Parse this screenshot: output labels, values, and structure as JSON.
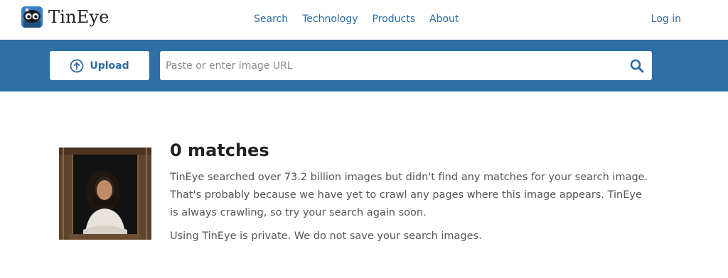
{
  "header": {
    "logo_text": "TinEye",
    "nav": [
      {
        "label": "Search"
      },
      {
        "label": "Technology"
      },
      {
        "label": "Products"
      },
      {
        "label": "About"
      }
    ],
    "login_label": "Log in"
  },
  "search": {
    "upload_label": "Upload",
    "url_placeholder": "Paste or enter image URL",
    "url_value": ""
  },
  "result": {
    "title": "0 matches",
    "message": "TinEye searched over 73.2 billion images but didn't find any matches for your search image. That's probably because we have yet to crawl any pages where this image appears. TinEye is always crawling, so try your search again soon.",
    "privacy": "Using TinEye is private. We do not save your search images."
  },
  "colors": {
    "brand_blue": "#2d6fa6",
    "link_blue": "#2b6aa3"
  },
  "icons": {
    "logo": "tineye-robot-logo",
    "upload": "upload-arrow-icon",
    "search": "search-icon"
  }
}
